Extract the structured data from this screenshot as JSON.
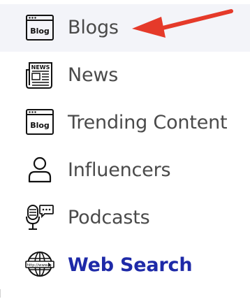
{
  "menu": {
    "items": [
      {
        "label": "Blogs",
        "icon": "blog-icon",
        "active": true
      },
      {
        "label": "News",
        "icon": "newspaper-icon",
        "active": false
      },
      {
        "label": "Trending Content",
        "icon": "blog-icon",
        "active": false
      },
      {
        "label": "Influencers",
        "icon": "person-icon",
        "active": false
      },
      {
        "label": "Podcasts",
        "icon": "microphone-icon",
        "active": false
      },
      {
        "label": "Web Search",
        "icon": "globe-icon",
        "active": false,
        "highlight": true
      }
    ],
    "icon_text": {
      "blog": "Blog",
      "news": "NEWS",
      "web": "http://www."
    }
  },
  "colors": {
    "text": "#4a4a4a",
    "highlight_text": "#1e2aa8",
    "active_background": "#f3f4f9",
    "arrow": "#e53a2a"
  }
}
